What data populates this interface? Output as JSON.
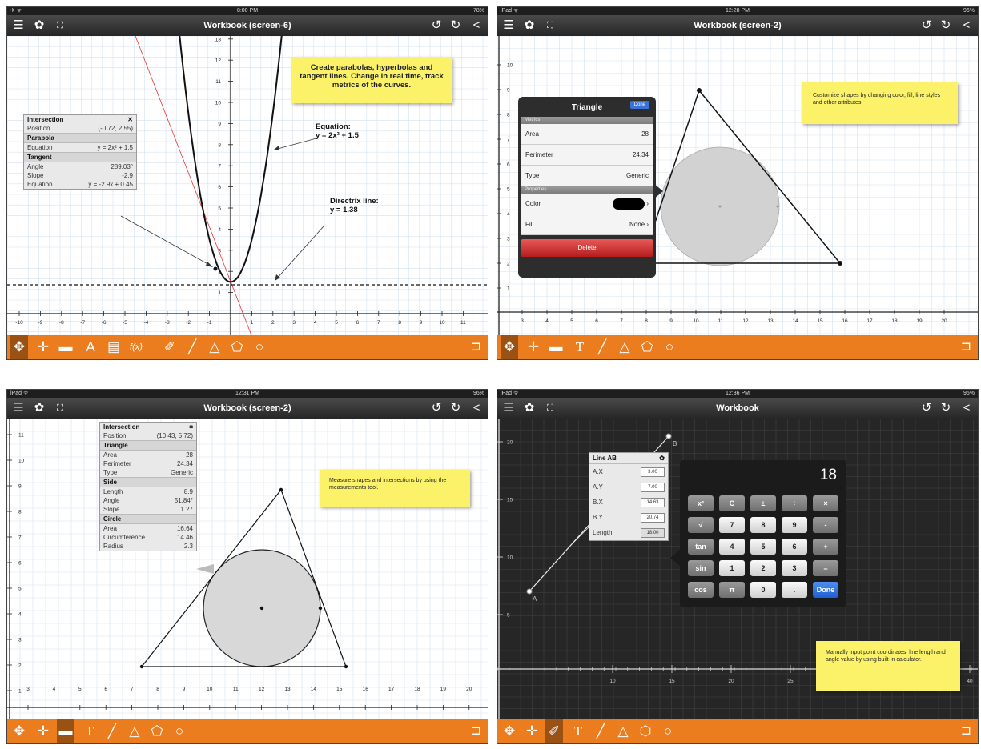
{
  "status": {
    "s1": {
      "left": "✈ ᯤ",
      "time": "8:00 PM",
      "battery": "78%"
    },
    "s2": {
      "left": "iPad ᯤ",
      "time": "12:28 PM",
      "battery": "96%"
    },
    "s3": {
      "left": "iPad ᯤ",
      "time": "12:31 PM",
      "battery": "96%"
    },
    "s4": {
      "left": "iPad ᯤ",
      "time": "12:36 PM",
      "battery": "96%"
    }
  },
  "nav": {
    "s1_title": "Workbook (screen-6)",
    "s2_title": "Workbook (screen-2)",
    "s3_title": "Workbook (screen-2)",
    "s4_title": "Workbook",
    "menu_icon": "☰",
    "gear_icon": "✿",
    "fullscreen_icon": "⛶",
    "undo_icon": "↺",
    "redo_icon": "↻",
    "share_icon": "<"
  },
  "s1": {
    "callout": "Create parabolas, hyperbolas and tangent lines. Change in real time, track metrics of the curves.",
    "equation_label": "Equation:",
    "equation": "y = 2x² + 1.5",
    "directrix_label": "Directrix line:",
    "directrix": "y = 1.38",
    "panel": {
      "title": "Intersection",
      "close": "✕",
      "position_label": "Position",
      "position": "(-0.72, 2.55)",
      "parabola": "Parabola",
      "equation_label": "Equation",
      "equation": "y = 2x² + 1.5",
      "tangent": "Tangent",
      "angle_label": "Angle",
      "angle": "289.03°",
      "slope_label": "Slope",
      "slope": "-2.9",
      "teq_label": "Equation",
      "teq": "y = -2.9x + 0.45"
    },
    "xticks": [
      "-10",
      "-9",
      "-8",
      "-7",
      "-6",
      "-5",
      "-4",
      "-3",
      "-2",
      "-1",
      "1",
      "2",
      "3",
      "4",
      "5",
      "6",
      "7",
      "8",
      "9",
      "10",
      "11"
    ],
    "yticks": [
      "1",
      "2",
      "3",
      "4",
      "5",
      "6",
      "7",
      "8",
      "9",
      "10",
      "11",
      "12",
      "13"
    ]
  },
  "s2": {
    "callout": "Customize shapes by changing color, fill, line styles and other attributes.",
    "pop": {
      "title": "Triangle",
      "done": "Done",
      "metrics": "Metrics",
      "area_label": "Area",
      "area": "28",
      "perimeter_label": "Perimeter",
      "perimeter": "24.34",
      "type_label": "Type",
      "type": "Generic",
      "properties": "Properties",
      "color_label": "Color",
      "fill_label": "Fill",
      "fill": "None",
      "chevron": "›",
      "delete": "Delete"
    },
    "xticks": [
      "3",
      "4",
      "5",
      "6",
      "7",
      "8",
      "9",
      "10",
      "11",
      "12",
      "13",
      "14",
      "15",
      "16",
      "17",
      "18",
      "19",
      "20"
    ],
    "yticks": [
      "1",
      "2",
      "3",
      "4",
      "5",
      "6",
      "7",
      "8",
      "9",
      "10"
    ]
  },
  "s3": {
    "callout": "Measure shapes and intersections by using the measurements tool.",
    "panel": {
      "title": "Intersection",
      "pin": "⌗",
      "position_label": "Position",
      "position": "(10.43, 5.72)",
      "triangle": "Triangle",
      "area_label": "Area",
      "area": "28",
      "perimeter_label": "Perimeter",
      "perimeter": "24.34",
      "type_label": "Type",
      "type": "Generic",
      "side": "Side",
      "length_label": "Length",
      "length": "8.9",
      "angle_label": "Angle",
      "angle": "51.84°",
      "slope_label": "Slope",
      "slope": "1.27",
      "circle": "Circle",
      "carea_label": "Area",
      "carea": "16.64",
      "circ_label": "Circumference",
      "circ": "14.46",
      "radius_label": "Radius",
      "radius": "2.3"
    },
    "xticks": [
      "3",
      "4",
      "5",
      "6",
      "7",
      "8",
      "9",
      "10",
      "11",
      "12",
      "13",
      "14",
      "15",
      "16",
      "17",
      "18",
      "19",
      "20"
    ],
    "yticks": [
      "1",
      "2",
      "3",
      "4",
      "5",
      "6",
      "7",
      "8",
      "9",
      "10",
      "11"
    ]
  },
  "s4": {
    "callout": "Manually input point coordinates, line length and angle value by using built-in calculator.",
    "point_a": "A",
    "point_b": "B",
    "panel": {
      "title": "Line AB",
      "ax_label": "A.X",
      "ax": "3.00",
      "ay_label": "A.Y",
      "ay": "7.00",
      "bx_label": "B.X",
      "bx": "14.63",
      "by_label": "B.Y",
      "by": "20.74",
      "len_label": "Length",
      "len": "18.00"
    },
    "calc": {
      "display": "18",
      "keys": [
        "x²",
        "C",
        "±",
        "÷",
        "×",
        "√",
        "7",
        "8",
        "9",
        "-",
        "tan",
        "4",
        "5",
        "6",
        "+",
        "sin",
        "1",
        "2",
        "3",
        "=",
        "cos",
        "π",
        "0",
        ".",
        "Done"
      ]
    },
    "xticks": [
      "10",
      "15",
      "20",
      "25",
      "30",
      "35",
      "40"
    ],
    "yticks": [
      "5",
      "10",
      "15",
      "20"
    ]
  },
  "tools": {
    "move": "✥",
    "point": "✛",
    "measure": "▬",
    "text_a": "A",
    "text_t": "T",
    "calendar": "▤",
    "fx": "f(x)",
    "pen": "✐",
    "line": "╱",
    "triangle": "△",
    "pentagon": "⬠",
    "hexagon": "⬡",
    "circle": "○",
    "exit": "⊐"
  }
}
